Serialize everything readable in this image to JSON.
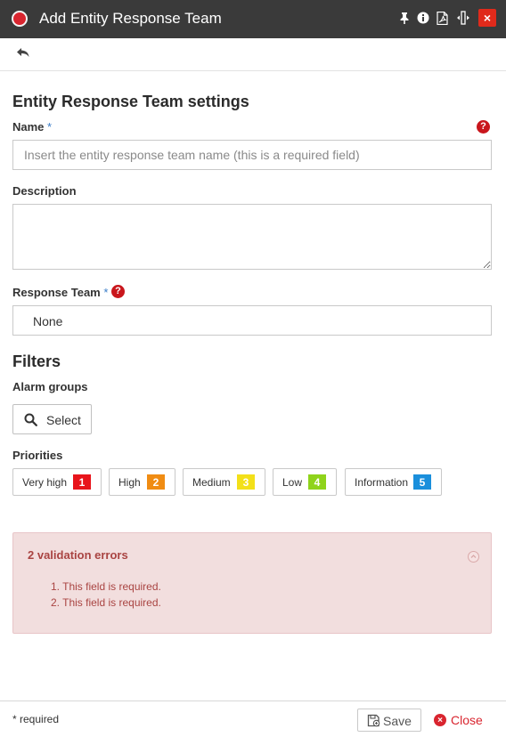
{
  "window": {
    "title": "Add Entity Response Team",
    "icons": [
      "pin-icon",
      "info-icon",
      "pdf-icon",
      "resize-icon",
      "close-icon"
    ],
    "close_glyph": "×"
  },
  "toolbar": {
    "back_icon": "reply-arrow-icon"
  },
  "section_title": "Entity Response Team settings",
  "form": {
    "name_label": "Name",
    "required_marker": "*",
    "name_value": "",
    "name_placeholder": "Insert the entity response team name (this is a required field)",
    "help_glyph": "?",
    "description_label": "Description",
    "description_value": "",
    "response_team_label": "Response Team",
    "response_team_value": "None"
  },
  "filters": {
    "title": "Filters",
    "alarm_groups_label": "Alarm groups",
    "select_button_label": "Select",
    "priorities_label": "Priorities",
    "priorities": [
      {
        "label": "Very high",
        "number": "1",
        "color": "#e8141b"
      },
      {
        "label": "High",
        "number": "2",
        "color": "#f08c13"
      },
      {
        "label": "Medium",
        "number": "3",
        "color": "#f3e019"
      },
      {
        "label": "Low",
        "number": "4",
        "color": "#8fd31b"
      },
      {
        "label": "Information",
        "number": "5",
        "color": "#1a8fdc"
      }
    ]
  },
  "validation": {
    "title": "2 validation errors",
    "errors": [
      "1. This field is required.",
      "2. This field is required."
    ]
  },
  "footer": {
    "required_note": "* required",
    "save_label": "Save",
    "close_label": "Close",
    "close_glyph": "×"
  },
  "colors": {
    "titlebar": "#3a3a3a",
    "accent_red": "#d9252f",
    "error_text": "#a94442",
    "error_bg": "#f2dede"
  }
}
